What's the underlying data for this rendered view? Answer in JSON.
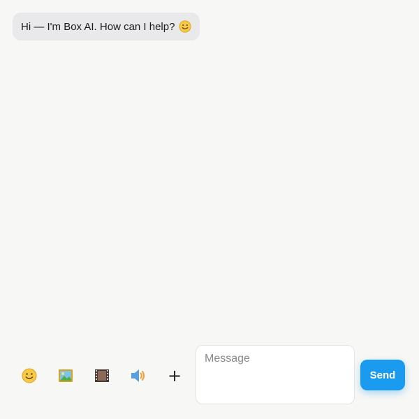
{
  "chat": {
    "greeting_text": "Hi — I'm Box AI. How can I help?"
  },
  "composer": {
    "tools": [
      {
        "icon": "emoji-icon"
      },
      {
        "icon": "image-icon"
      },
      {
        "icon": "video-icon"
      },
      {
        "icon": "audio-icon"
      },
      {
        "icon": "plus-icon",
        "label": "+"
      }
    ],
    "message_placeholder": "Message",
    "message_value": "",
    "send_label": "Send"
  },
  "colors": {
    "background": "#f7f7f5",
    "bubble": "#e9e9eb",
    "accent": "#1a9bf0"
  }
}
